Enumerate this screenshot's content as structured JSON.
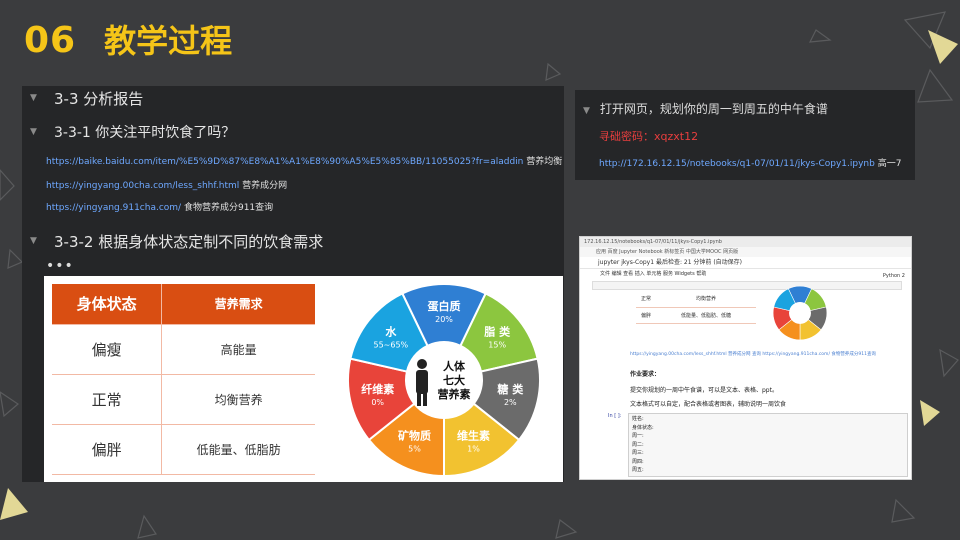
{
  "header": {
    "number": "06",
    "title": "教学过程"
  },
  "left_notebook": {
    "heading_main": "3-3 分析报告",
    "heading_sub1": "3-3-1 你关注平时饮食了吗？",
    "links": [
      {
        "url": "https://baike.baidu.com/item/%E5%9D%87%E8%A1%A1%E8%90%A5%E5%85%BB/11055025?fr=aladdin",
        "label": "营养均衡"
      },
      {
        "url": "https://yingyang.00cha.com/less_shhf.html",
        "label": "营养成分网"
      },
      {
        "url": "https://yingyang.911cha.com/",
        "label": "食物营养成分911查询"
      }
    ],
    "heading_sub2": "3-3-2 根据身体状态定制不同的饮食需求",
    "ellipsis": "•••",
    "table": {
      "header": [
        "身体状态",
        "营养需求"
      ],
      "rows": [
        [
          "偏瘦",
          "高能量"
        ],
        [
          "正常",
          "均衡营养"
        ],
        [
          "偏胖",
          "低能量、低脂肪"
        ]
      ]
    },
    "wheel": {
      "center": [
        "人体",
        "七大",
        "营养素"
      ],
      "segments": [
        {
          "name": "蛋白质",
          "value": "20%",
          "color": "#2f7fd3"
        },
        {
          "name": "脂 类",
          "value": "15%",
          "color": "#8cc63f"
        },
        {
          "name": "糖 类",
          "value": "2%",
          "color": "#6b6b6b"
        },
        {
          "name": "维生素",
          "value": "1%",
          "color": "#f2c230"
        },
        {
          "name": "矿物质",
          "value": "5%",
          "color": "#f5901e"
        },
        {
          "name": "纤维素",
          "value": "0%",
          "color": "#e8443a"
        },
        {
          "name": "水",
          "value": "55~65%",
          "color": "#1aa3e0"
        }
      ]
    }
  },
  "right_panel": {
    "line1": "打开网页，规划你的周一到周五的中午食谱",
    "line2": "寻础密码：xqzxt12",
    "url": "http://172.16.12.15/notebooks/q1-07/01/11/jkys-Copy1.ipynb",
    "url_label": "高一7"
  },
  "browser": {
    "address": "172.16.12.15/notebooks/q1-07/01/11/jkys-Copy1.ipynb",
    "bookmarks": "应用   百度   Jupyter Notebook   新标签页   中国大学MOOC   网页版",
    "notebook_title": "jupyter  jkys-Copy1 最后检查: 21 分钟前 (自动保存)",
    "menu": "文件   编辑   查看   插入   单元格   服务   Widgets   帮助",
    "kernel": "Python 2",
    "mini_table": [
      [
        "正常",
        "均衡营养"
      ],
      [
        "偏胖",
        "低能量、低脂肪、低糖"
      ]
    ],
    "small_links": "https://yingyang.00cha.com/less_shhf.html 营养成分网 查询 https://yingyang.911cha.com/ 食物营养成分911查询",
    "task_title": "作业要求：",
    "task_line1": "提交你规划的一周中午食谱，可以是文本、表格、ppt。",
    "task_line2": "文本格式可以自定，配合表格或者图表，辅助说明一周饮食",
    "cell_prompt": "In [ ]:",
    "cell_lines": [
      "姓名:",
      "身体状态:",
      "周一:",
      "周二:",
      "周三:",
      "周四:",
      "周五:"
    ]
  },
  "colors": {
    "accent": "#f5c518",
    "bg": "#3b3c3e",
    "panel": "#252628",
    "table_head": "#d94e12"
  }
}
